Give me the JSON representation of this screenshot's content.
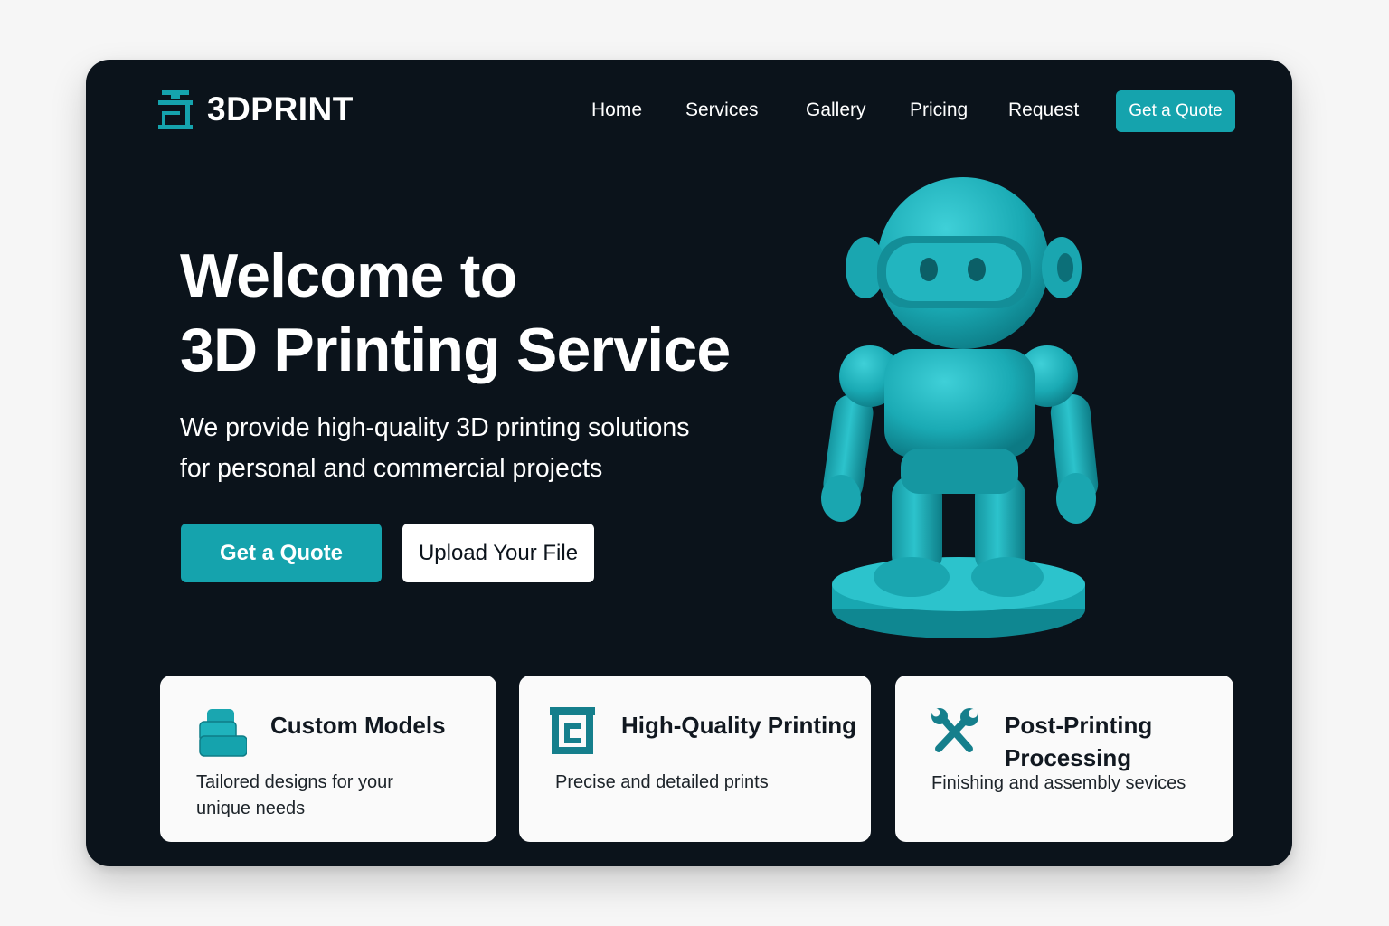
{
  "colors": {
    "accent": "#15a3ad",
    "background": "#0b131b",
    "page_background": "#f6f6f6",
    "card_background": "#fafafa",
    "text_light": "#ffffff",
    "text_dark": "#111820",
    "icon_accent": "#157f8c"
  },
  "header": {
    "logo_icon": "3d-printer-icon",
    "logo_text": "3DPRINT",
    "nav": {
      "home": "Home",
      "services": "Services",
      "gallery": "Gallery",
      "pricing": "Pricing",
      "request": "Request"
    },
    "cta_label": "Get a Quote"
  },
  "hero": {
    "title_line1": "Welcome to",
    "title_line2": "3D Printing Service",
    "subtitle_line1": "We provide high-quality 3D printing solutions",
    "subtitle_line2": "for personal and commercial projects",
    "primary_button": "Get a Quote",
    "secondary_button": "Upload Your File",
    "illustration": "robot-figurine"
  },
  "features": {
    "custom_models": {
      "icon": "layers-block-icon",
      "title": "Custom Models",
      "desc_line1": "Tailored designs for your",
      "desc_line2": "unique needs"
    },
    "high_quality": {
      "icon": "printer-frame-icon",
      "title": "High-Quality Printing",
      "desc_line1": "Precise and detailed prints"
    },
    "post_processing": {
      "icon": "tools-icon",
      "title_line1": "Post-Printing",
      "title_line2": "Processing",
      "desc_line1": "Finishing and assembly sevices"
    }
  }
}
